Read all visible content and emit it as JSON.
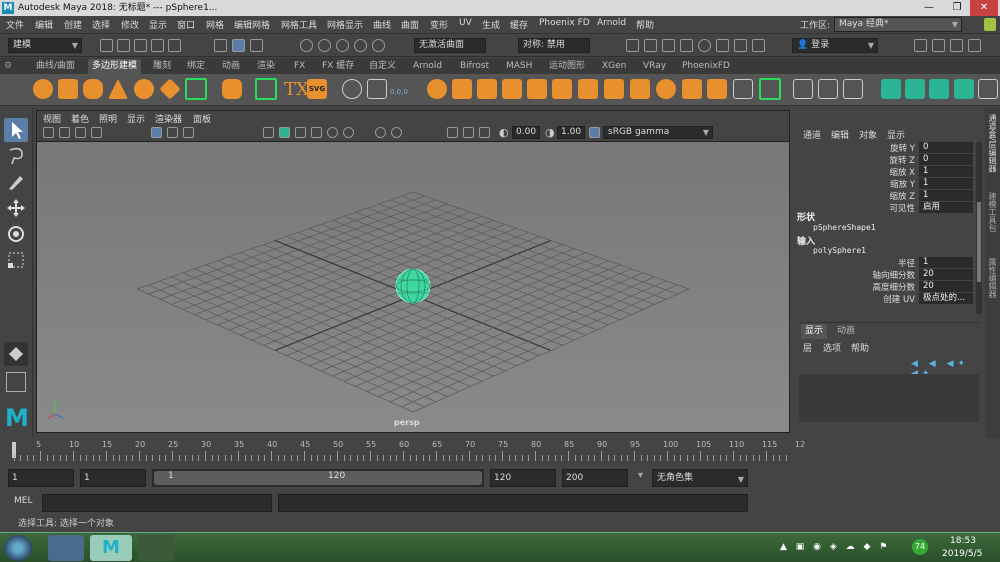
{
  "window": {
    "title": "Autodesk Maya 2018: 无标题*   ---   pSphere1...",
    "logo": "M"
  },
  "menu": [
    "文件",
    "编辑",
    "创建",
    "选择",
    "修改",
    "显示",
    "窗口",
    "网格",
    "编辑网格",
    "网格工具",
    "网格显示",
    "曲线",
    "曲面",
    "变形",
    "UV",
    "生成",
    "缓存",
    "Phoenix FD",
    "Arnold",
    "帮助"
  ],
  "workspace": {
    "label": "工作区:",
    "value": "Maya 经典*"
  },
  "statusline": {
    "mode": "建模",
    "live": "无激活曲面",
    "symmetry": "对称: 禁用",
    "login": "登录"
  },
  "shelf_tabs": [
    "曲线/曲面",
    "多边形建模",
    "雕刻",
    "绑定",
    "动画",
    "渲染",
    "FX",
    "FX 缓存",
    "自定义",
    "Arnold",
    "Bifrost",
    "MASH",
    "运动图形",
    "XGen",
    "VRay",
    "PhoenixFD"
  ],
  "shelf_active": 1,
  "shelf_text": {
    "tx": "TX",
    "svg": "SVG",
    "coords": "0,0,0"
  },
  "viewport": {
    "menu": [
      "视图",
      "着色",
      "照明",
      "显示",
      "渲染器",
      "面板"
    ],
    "exposure": "0.00",
    "gamma": "1.00",
    "colorspace": "sRGB gamma",
    "camera": "persp"
  },
  "channel_box": {
    "tabs": [
      "通道",
      "编辑",
      "对象",
      "显示"
    ],
    "rows": [
      {
        "label": "旋转 Y",
        "value": "0"
      },
      {
        "label": "旋转 Z",
        "value": "0"
      },
      {
        "label": "缩放 X",
        "value": "1"
      },
      {
        "label": "缩放 Y",
        "value": "1"
      },
      {
        "label": "缩放 Z",
        "value": "1"
      },
      {
        "label": "可见性",
        "value": "启用"
      }
    ],
    "shapes_header": "形状",
    "shape_name": "pSphereShape1",
    "inputs_header": "输入",
    "input_name": "polySphere1",
    "input_rows": [
      {
        "label": "半径",
        "value": "1"
      },
      {
        "label": "轴向细分数",
        "value": "20"
      },
      {
        "label": "高度细分数",
        "value": "20"
      },
      {
        "label": "创建 UV",
        "value": "极点处的..."
      }
    ]
  },
  "layer_editor": {
    "tabs": [
      "显示",
      "动画"
    ],
    "menu": [
      "层",
      "选项",
      "帮助"
    ]
  },
  "side_tabs": [
    "通道盒/层编辑器",
    "建模工具包",
    "属性编辑器"
  ],
  "timeline": {
    "ticks": [
      "5",
      "10",
      "15",
      "20",
      "25",
      "30",
      "35",
      "40",
      "45",
      "50",
      "55",
      "60",
      "65",
      "70",
      "75",
      "80",
      "85",
      "90",
      "95",
      "100",
      "105",
      "110",
      "115",
      "12"
    ]
  },
  "range": {
    "start": "1",
    "current": "1",
    "slider_start": "1",
    "slider_end": "120",
    "end": "120",
    "max": "200",
    "character": "无角色集"
  },
  "mel": {
    "label": "MEL"
  },
  "help": "选择工具: 选择一个对象",
  "taskbar": {
    "time": "18:53",
    "date": "2019/5/5",
    "badge": "74"
  }
}
